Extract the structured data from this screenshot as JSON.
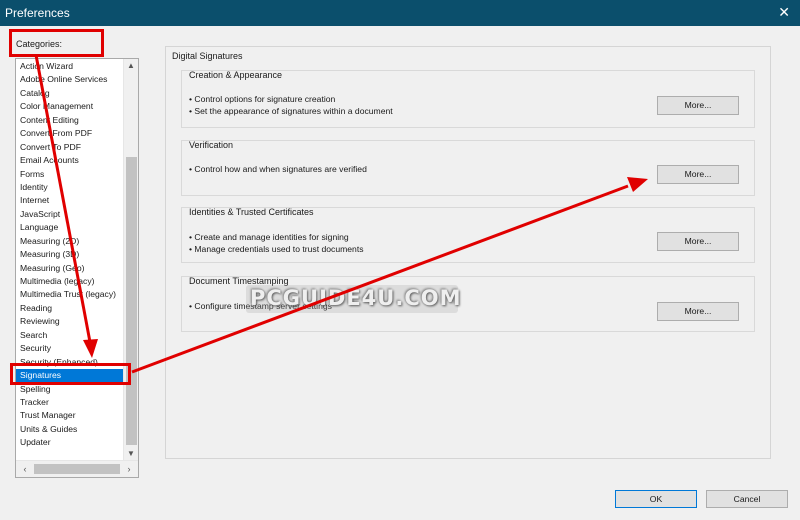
{
  "window": {
    "title": "Preferences",
    "close_glyph": "✕"
  },
  "categories": {
    "label": "Categories:",
    "items": [
      "Action Wizard",
      "Adobe Online Services",
      "Catalog",
      "Color Management",
      "Content Editing",
      "Convert From PDF",
      "Convert To PDF",
      "Email Accounts",
      "Forms",
      "Identity",
      "Internet",
      "JavaScript",
      "Language",
      "Measuring (2D)",
      "Measuring (3D)",
      "Measuring (Geo)",
      "Multimedia (legacy)",
      "Multimedia Trust (legacy)",
      "Reading",
      "Reviewing",
      "Search",
      "Security",
      "Security (Enhanced)",
      "Signatures",
      "Spelling",
      "Tracker",
      "Trust Manager",
      "Units & Guides",
      "Updater"
    ],
    "selected": "Signatures",
    "scroll_up": "▲",
    "scroll_down": "▼",
    "scroll_left": "‹",
    "scroll_right": "›"
  },
  "main": {
    "title": "Digital Signatures",
    "groups": [
      {
        "title": "Creation & Appearance",
        "lines": [
          "• Control options for signature creation",
          "• Set the appearance of signatures within a document"
        ],
        "button": "More..."
      },
      {
        "title": "Verification",
        "lines": [
          "• Control how and when signatures are verified"
        ],
        "button": "More..."
      },
      {
        "title": "Identities & Trusted Certificates",
        "lines": [
          "• Create and manage identities for signing",
          "• Manage credentials used to trust documents"
        ],
        "button": "More..."
      },
      {
        "title": "Document Timestamping",
        "lines": [
          "• Configure timestamp server settings"
        ],
        "button": "More..."
      }
    ]
  },
  "footer": {
    "ok": "OK",
    "cancel": "Cancel"
  },
  "watermark": "PCGUIDE4U.COM",
  "colors": {
    "titlebar": "#0b4f6c",
    "selection": "#0078d7",
    "annotation": "#e00000"
  }
}
